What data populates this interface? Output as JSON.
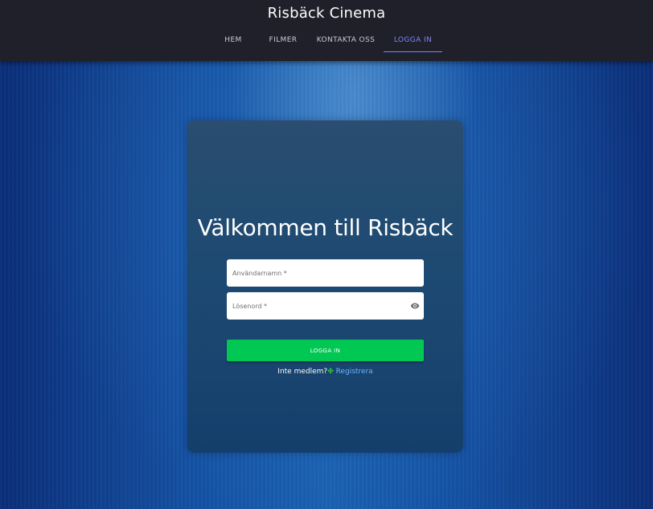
{
  "header": {
    "brand": "Risbäck Cinema",
    "nav": [
      {
        "label": "HEM",
        "active": false
      },
      {
        "label": "FILMER",
        "active": false
      },
      {
        "label": "KONTAKTA OSS",
        "active": false
      },
      {
        "label": "LOGGA IN",
        "active": true
      }
    ],
    "active_color": "#7e86ff",
    "background_color": "#1f2029"
  },
  "login": {
    "title": "Välkommen till Risbäck",
    "username": {
      "value": "",
      "placeholder": "Användarnamn *"
    },
    "password": {
      "value": "",
      "placeholder": "Lösenord *",
      "icon": "eye-icon"
    },
    "submit_label": "LOGGA IN",
    "submit_color": "#00c853",
    "signup_prompt": "Inte medlem?",
    "signup_icon": "clover-icon",
    "register_label": "Registrera",
    "register_color": "#6fb7ff"
  }
}
